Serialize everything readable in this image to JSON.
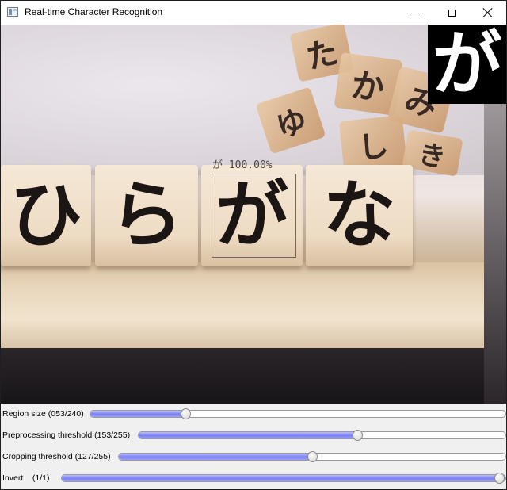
{
  "window": {
    "title": "Real-time Character Recognition",
    "icons": {
      "app": "app-window-icon",
      "minimize": "minimize-icon",
      "maximize": "maximize-icon",
      "close": "close-icon"
    }
  },
  "camera": {
    "blocks": [
      "ひ",
      "ら",
      "が",
      "な"
    ],
    "background_blocks": [
      "た",
      "か",
      "ゆ",
      "み",
      "し",
      "き"
    ],
    "detection": {
      "text": "が 100.00%"
    },
    "preview_char": "が"
  },
  "controls": {
    "sliders": [
      {
        "label": "Region size (053/240)",
        "value": 53,
        "max": 240
      },
      {
        "label": "Preprocessing threshold (153/255)",
        "value": 153,
        "max": 255
      },
      {
        "label": "Cropping threshold (127/255)",
        "value": 127,
        "max": 255
      },
      {
        "label": "Invert    (1/1)",
        "value": 1,
        "max": 1
      }
    ]
  },
  "colors": {
    "slider_fill": "#7a80f2",
    "window_bg": "#f0f0f0",
    "title_bg": "#ffffff"
  }
}
